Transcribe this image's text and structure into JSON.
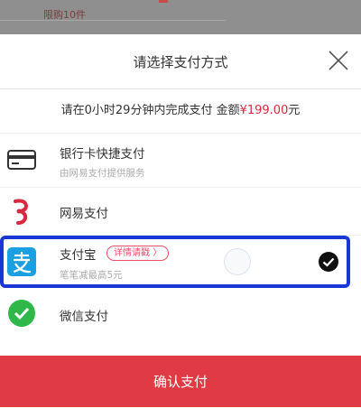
{
  "background": {
    "limit_text": "限购10件"
  },
  "header": {
    "title": "请选择支付方式"
  },
  "notice": {
    "prefix": "请在0小时29分钟内完成支付 金额",
    "amount": "¥199.00",
    "suffix": "元"
  },
  "options": [
    {
      "name": "银行卡快捷支付",
      "sub": "由网易支付提供服务",
      "icon": "bank-card-icon"
    },
    {
      "name": "网易支付",
      "icon": "netease-pay-icon"
    },
    {
      "name": "支付宝",
      "promo": "详情请戳",
      "sub": "笔笔减最高5元",
      "icon": "alipay-icon",
      "selected": true
    },
    {
      "name": "微信支付",
      "icon": "wechat-pay-icon"
    }
  ],
  "confirm": {
    "label": "确认支付"
  },
  "colors": {
    "accent": "#e03a45",
    "amount": "#d8283f",
    "selection_box": "#1a36d6",
    "alipay": "#1a9fe0",
    "wechat": "#2fb84a"
  }
}
